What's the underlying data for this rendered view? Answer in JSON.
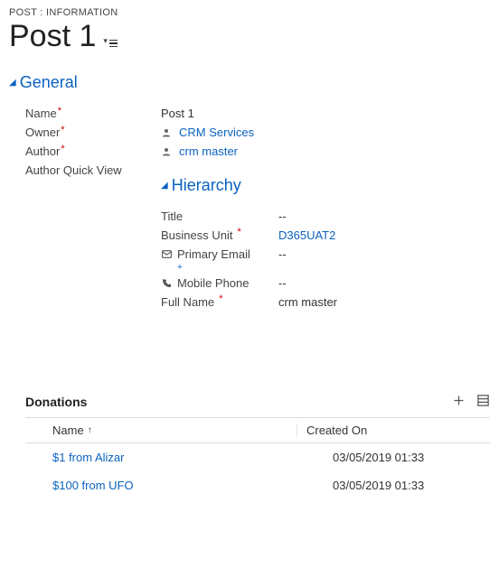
{
  "breadcrumb": "POST : INFORMATION",
  "page_title": "Post 1",
  "sections": {
    "general": {
      "title": "General",
      "fields": {
        "name": {
          "label": "Name",
          "value": "Post 1",
          "required": true
        },
        "owner": {
          "label": "Owner",
          "value": "CRM Services",
          "required": true
        },
        "author": {
          "label": "Author",
          "value": "crm master",
          "required": true
        },
        "authorQV": {
          "label": "Author Quick View"
        }
      }
    },
    "hierarchy": {
      "title": "Hierarchy",
      "fields": {
        "title": {
          "label": "Title",
          "value": "--"
        },
        "bu": {
          "label": "Business Unit",
          "value": "D365UAT2",
          "required": true
        },
        "email": {
          "label": "Primary Email",
          "value": "--"
        },
        "phone": {
          "label": "Mobile Phone",
          "value": "--"
        },
        "fullname": {
          "label": "Full Name",
          "value": "crm master",
          "required": true
        }
      }
    }
  },
  "donations": {
    "title": "Donations",
    "columns": {
      "name": "Name",
      "created": "Created On"
    },
    "rows": [
      {
        "name": "$1 from Alizar",
        "created": "03/05/2019 01:33"
      },
      {
        "name": "$100 from UFO",
        "created": "03/05/2019 01:33"
      }
    ]
  }
}
